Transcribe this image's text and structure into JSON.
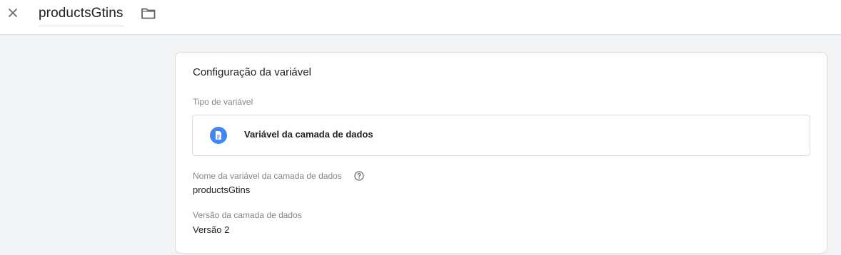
{
  "header": {
    "title": "productsGtins",
    "close_icon": "close-icon",
    "folder_icon": "folder-icon"
  },
  "card": {
    "title": "Configuração da variável",
    "type_section": {
      "label": "Tipo de variável",
      "type_name": "Variável da camada de dados",
      "type_icon": "document-icon",
      "icon_color": "#4285f4"
    },
    "name_field": {
      "label": "Nome da variável da camada de dados",
      "help_icon": "help-icon",
      "value": "productsGtins"
    },
    "version_field": {
      "label": "Versão da camada de dados",
      "value": "Versão 2"
    }
  }
}
